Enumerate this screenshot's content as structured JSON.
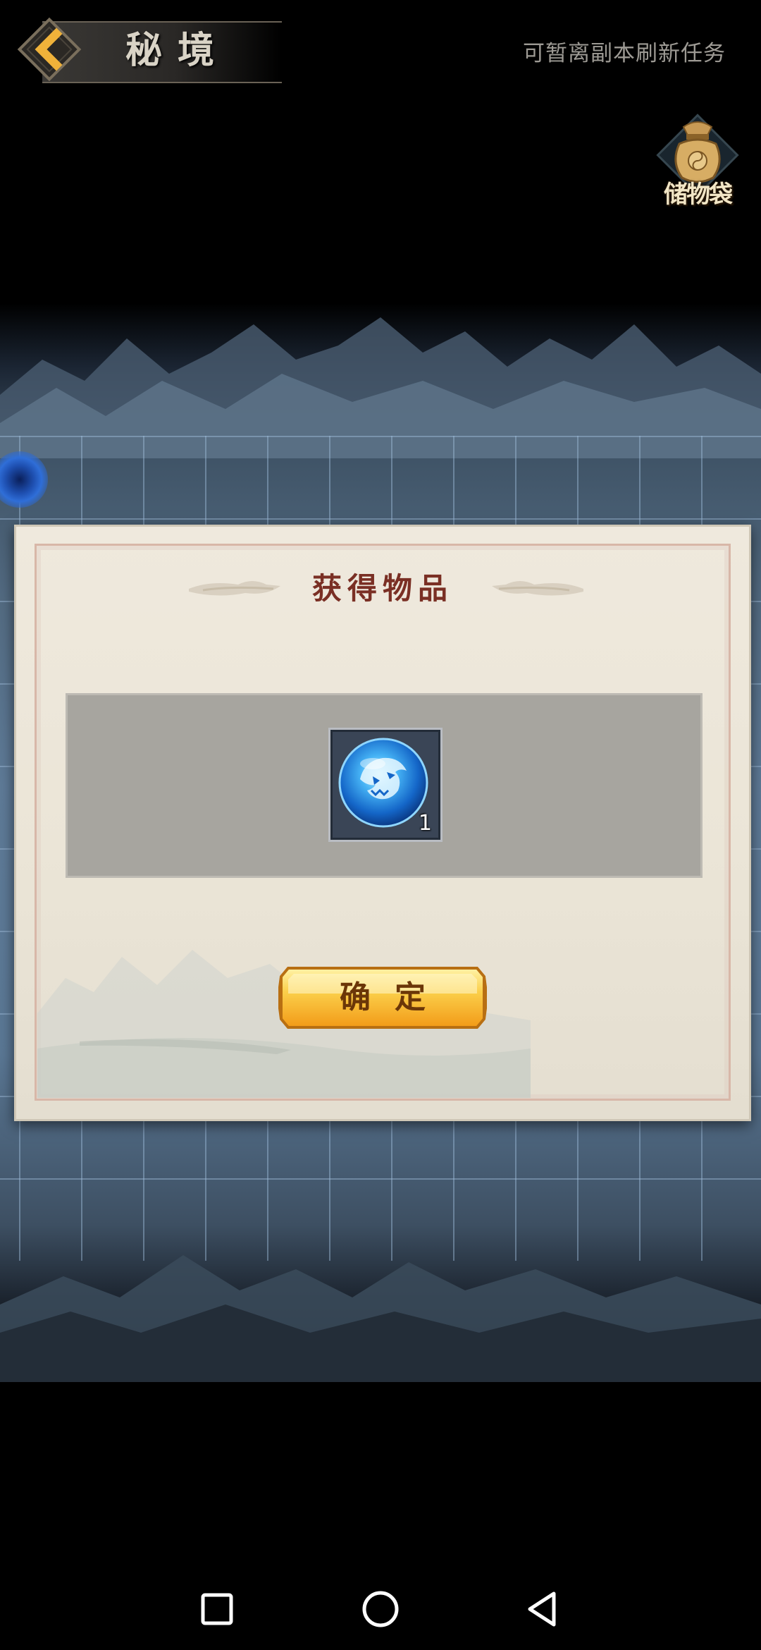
{
  "header": {
    "title": "秘境",
    "hint": "可暂离副本刷新任务",
    "back_icon": "chevron-left-icon",
    "bag_label": "储物袋",
    "bag_icon": "pouch-icon"
  },
  "dialog": {
    "title": "获得物品",
    "items": [
      {
        "icon": "blue-beast-orb-icon",
        "count": "1"
      }
    ],
    "confirm_label": "确定"
  },
  "system_nav": {
    "recents_icon": "square-icon",
    "home_icon": "circle-icon",
    "back_icon": "triangle-back-icon"
  },
  "colors": {
    "dialog_title": "#7a2f24",
    "button_gold": "#f5b429",
    "button_text": "#6b3608",
    "map_blue": "#5a7794"
  }
}
